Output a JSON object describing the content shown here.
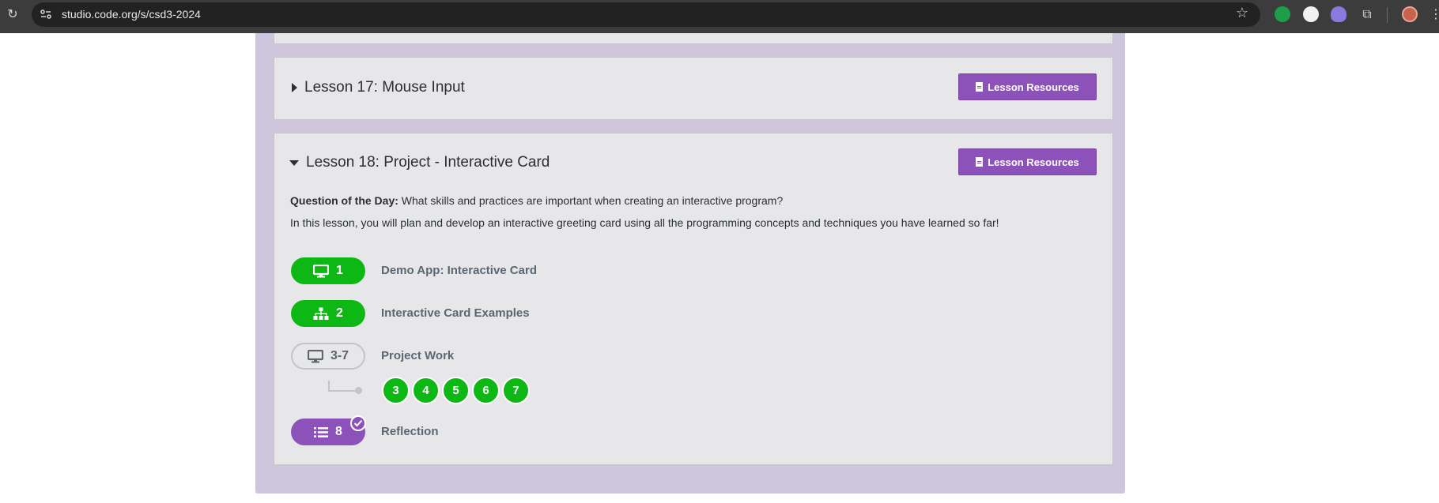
{
  "browser": {
    "url": "studio.code.org/s/csd3-2024"
  },
  "lessons": [
    {
      "title": "Lesson 17: Mouse Input",
      "expanded": false,
      "resources_label": "Lesson Resources"
    },
    {
      "title": "Lesson 18: Project - Interactive Card",
      "expanded": true,
      "resources_label": "Lesson Resources",
      "question_label": "Question of the Day:",
      "question_text": " What skills and practices are important when creating an interactive program?",
      "overview": "In this lesson, you will plan and develop an interactive greeting card using all the programming concepts and techniques you have learned so far!",
      "levels": [
        {
          "number": "1",
          "icon": "desktop-icon",
          "label": "Demo App: Interactive Card",
          "status": "completed"
        },
        {
          "number": "2",
          "icon": "sitemap-icon",
          "label": "Interactive Card Examples",
          "status": "completed"
        },
        {
          "number": "3-7",
          "icon": "desktop-icon",
          "label": "Project Work",
          "status": "not-started"
        },
        {
          "number": "8",
          "icon": "list-icon",
          "label": "Reflection",
          "status": "submitted"
        }
      ],
      "sublevels": [
        "3",
        "4",
        "5",
        "6",
        "7"
      ]
    }
  ],
  "colors": {
    "completed": "#0eb814",
    "submitted": "#8c52ba",
    "accent": "#8c52ba",
    "panel": "#cdc6dd"
  }
}
